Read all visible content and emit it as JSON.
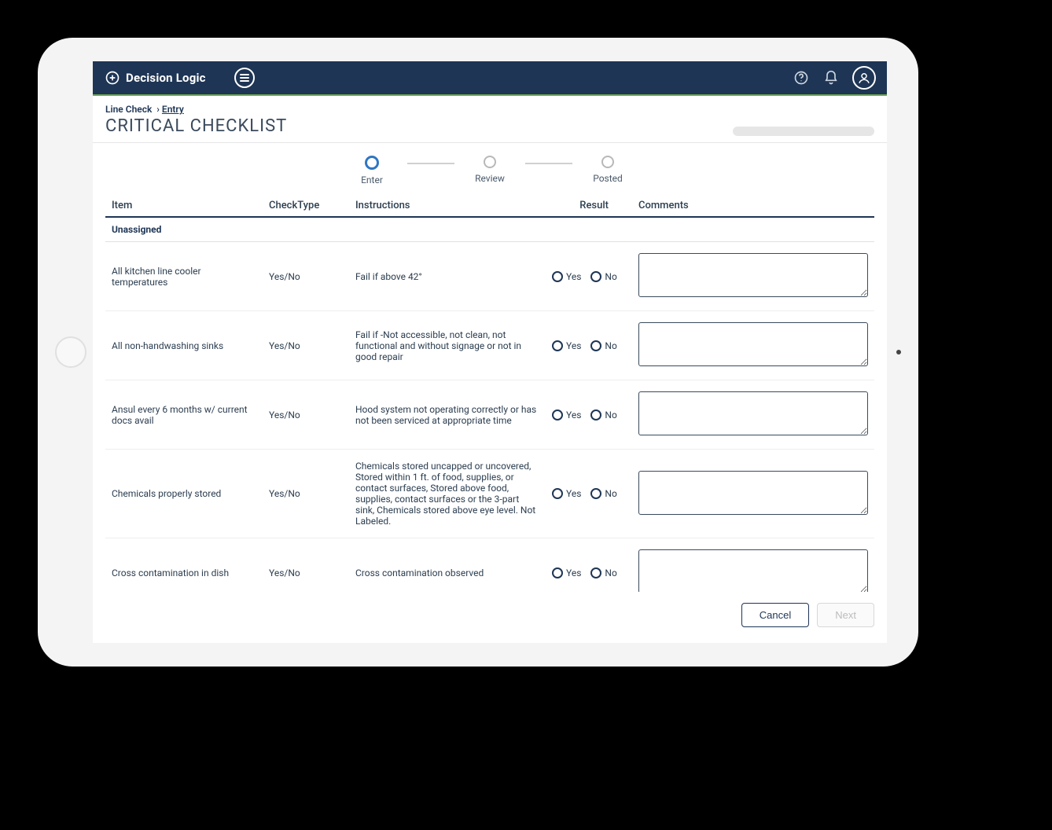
{
  "brand": "Decision Logic",
  "breadcrumb": {
    "root": "Line Check",
    "current": "Entry"
  },
  "page_title": "CRITICAL CHECKLIST",
  "stepper": [
    {
      "label": "Enter",
      "active": true
    },
    {
      "label": "Review",
      "active": false
    },
    {
      "label": "Posted",
      "active": false
    }
  ],
  "columns": {
    "item": "Item",
    "checktype": "CheckType",
    "instructions": "Instructions",
    "result": "Result",
    "comments": "Comments"
  },
  "group_label": "Unassigned",
  "result_options": {
    "yes": "Yes",
    "no": "No"
  },
  "rows": [
    {
      "item": "All kitchen line cooler temperatures",
      "checktype": "Yes/No",
      "instructions": "Fail if above 42°",
      "comments": ""
    },
    {
      "item": "All non-handwashing sinks",
      "checktype": "Yes/No",
      "instructions": "Fail if -Not accessible, not clean, not functional and without signage or not in good repair",
      "comments": ""
    },
    {
      "item": "Ansul every 6 months w/ current docs avail",
      "checktype": "Yes/No",
      "instructions": "Hood system not operating correctly or has not been serviced at appropriate time",
      "comments": ""
    },
    {
      "item": "Chemicals properly stored",
      "checktype": "Yes/No",
      "instructions": "Chemicals stored uncapped or uncovered, Stored within 1 ft. of food, supplies, or contact surfaces, Stored above food, supplies, contact surfaces or the 3-part sink, Chemicals stored above eye level. Not Labeled.",
      "comments": ""
    },
    {
      "item": "Cross contamination in dish",
      "checktype": "Yes/No",
      "instructions": "Cross contamination observed",
      "comments": ""
    }
  ],
  "footer": {
    "cancel": "Cancel",
    "next": "Next"
  }
}
